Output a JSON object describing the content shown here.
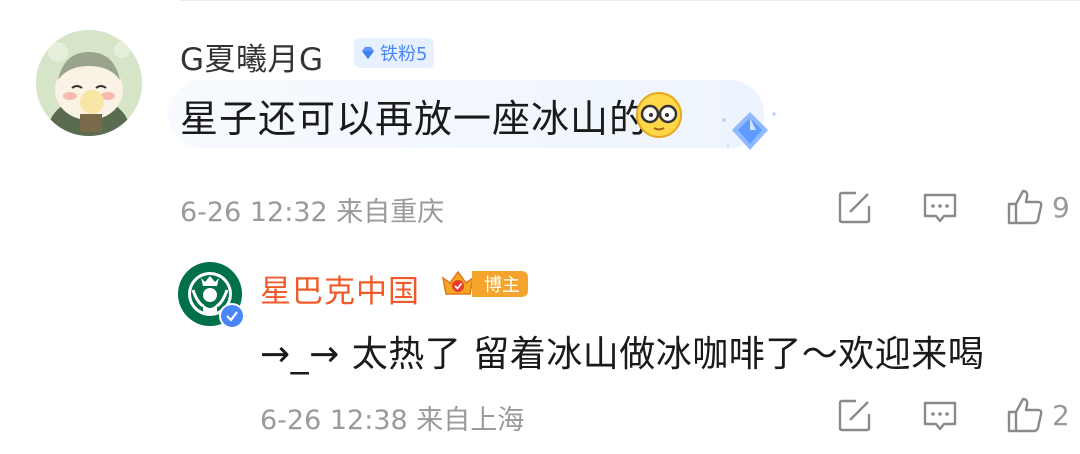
{
  "comment": {
    "username": "G夏曦月G",
    "fan_badge": "铁粉5",
    "text": "星子还可以再放一座冰山的",
    "meta": "6-26 12:32 来自重庆",
    "like_count": "9"
  },
  "reply": {
    "username": "星巴克中国",
    "badge": "博主",
    "text": "→_→ 太热了 留着冰山做冰咖啡了～欢迎来喝",
    "meta": "6-26 12:38 来自上海",
    "like_count": "2"
  },
  "colors": {
    "accent_name": "#f05a2a",
    "badge_blue": "#4a86f7",
    "meta_gray": "#9a9a9a",
    "starbucks_green": "#00704a"
  },
  "icons": [
    "edit-icon",
    "comment-icon",
    "thumbs-up-icon",
    "diamond-icon",
    "crown-icon",
    "verified-icon",
    "glasses-emoji-icon"
  ]
}
